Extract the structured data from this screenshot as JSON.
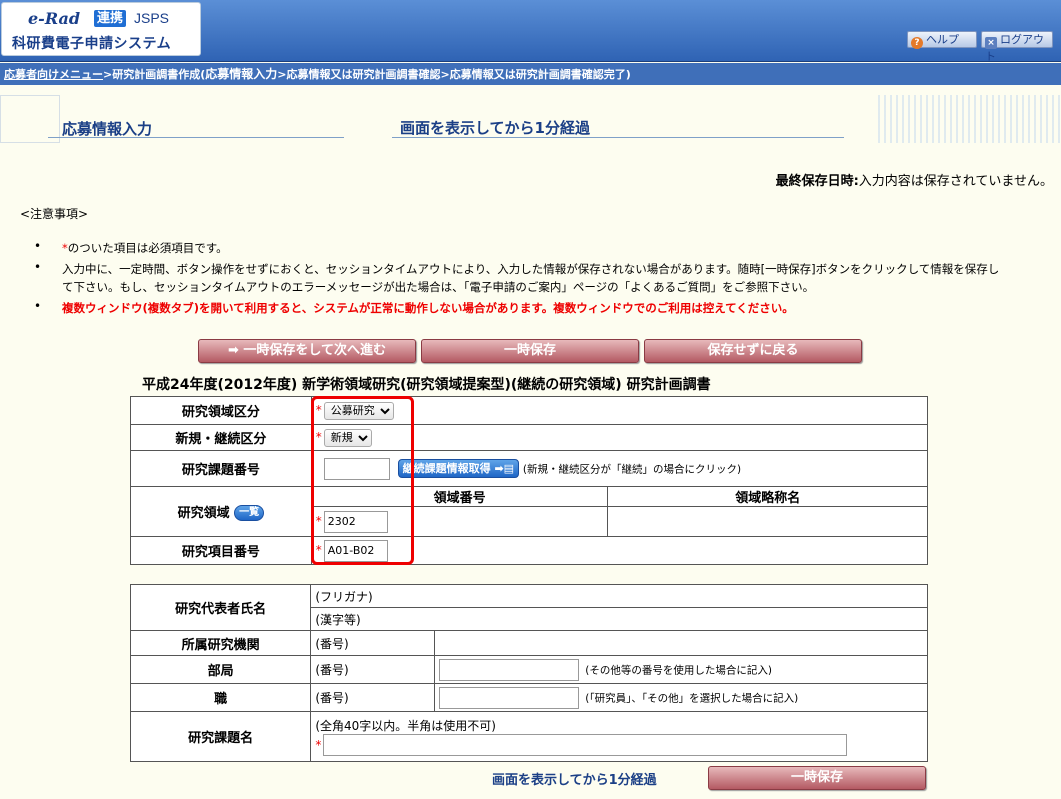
{
  "header": {
    "logo_erad": "e-Rad",
    "logo_renkei": "連携",
    "logo_jsps": "JSPS",
    "logo_system": "科研費電子申請システム",
    "help_label": "ヘルプ",
    "logout_label": "ログアウト"
  },
  "breadcrumb": {
    "menu_link": "応募者向けメニュー",
    "step1": ">研究計画調書作成(",
    "current": "応募情報入力",
    "step2": ">応募情報又は研究計画調書確認>応募情報又は研究計画調書確認完了)"
  },
  "page": {
    "title": "応募情報入力",
    "timer": "画面を表示してから1分経過",
    "last_saved_label": "最終保存日時:",
    "last_saved_value": "入力内容は保存されていません。"
  },
  "notes": {
    "heading": "<注意事項>",
    "bullet": "•",
    "required_mark": "*",
    "note1": "のついた項目は必須項目です。",
    "note2_line1": "入力中に、一定時間、ボタン操作をせずにおくと、セッションタイムアウトにより、入力した情報が保存されない場合があります。随時[一時保存]ボタンをクリックして情報を保存し",
    "note2_line2": "て下さい。もし、セッションタイムアウトのエラーメッセージが出た場合は、「電子申請のご案内」ページの「よくあるご質問」をご参照下さい。",
    "note3": "複数ウィンドウ(複数タブ)を開いて利用すると、システムが正常に動作しない場合があります。複数ウィンドウでのご利用は控えてください。"
  },
  "actions": {
    "save_next": "➡ 一時保存をして次へ進む",
    "save": "一時保存",
    "back": "保存せずに戻る",
    "save_bottom": "一時保存",
    "timer_bottom": "画面を表示してから1分経過"
  },
  "form": {
    "title": "平成24年度(2012年度) 新学術領域研究(研究領域提案型)(継続の研究領域) 研究計画調書",
    "required_mark": "*",
    "area_category_label": "研究領域区分",
    "area_category_value": "公募研究",
    "new_continue_label": "新規・継続区分",
    "new_continue_value": "新規",
    "project_number_label": "研究課題番号",
    "project_number_value": "",
    "fetch_button": "継続課題情報取得",
    "fetch_note": "(新規・継続区分が「継続」の場合にクリック)",
    "research_area_label": "研究領域",
    "list_button": "一覧",
    "col_area_number": "領域番号",
    "col_area_abbr": "領域略称名",
    "area_number_value": "2302",
    "item_number_label": "研究項目番号",
    "item_number_value": "A01-B02"
  },
  "form2": {
    "pi_name_label": "研究代表者氏名",
    "furigana_label": "(フリガナ)",
    "kanji_label": "(漢字等)",
    "institution_label": "所属研究機関",
    "department_label": "部局",
    "position_label": "職",
    "number_label": "(番号)",
    "department_note": "(その他等の番号を使用した場合に記入)",
    "position_note": "(「研究員」、「その他」を選択した場合に記入)",
    "project_title_label": "研究課題名",
    "project_title_hint": "(全角40字以内。半角は使用不可)"
  }
}
